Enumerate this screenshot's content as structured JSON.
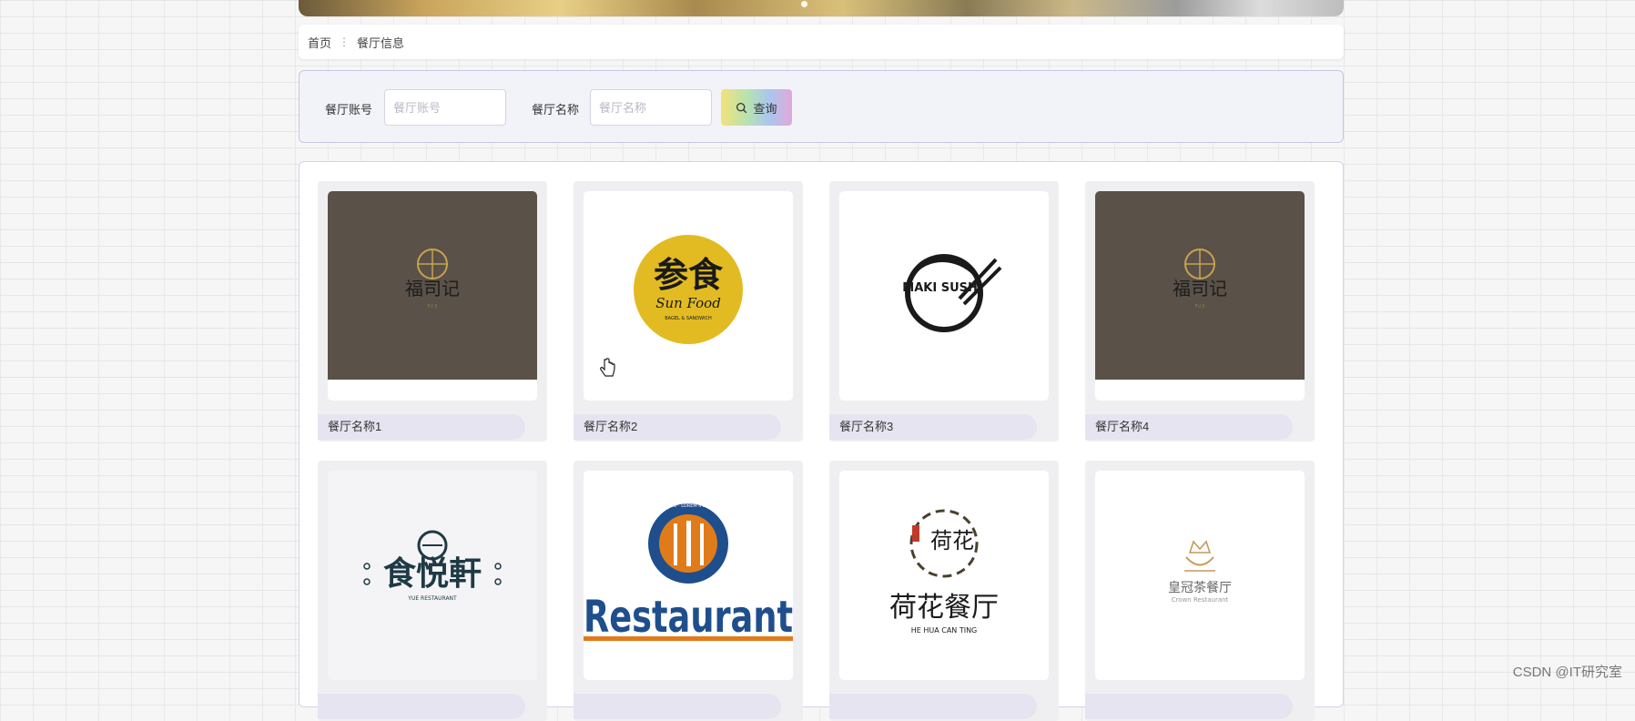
{
  "breadcrumb": {
    "home": "首页",
    "current": "餐厅信息"
  },
  "search": {
    "account_label": "餐厅账号",
    "account_placeholder": "餐厅账号",
    "account_value": "",
    "name_label": "餐厅名称",
    "name_placeholder": "餐厅名称",
    "name_value": "",
    "button_label": "查询",
    "button_icon": "search-icon"
  },
  "restaurants": [
    {
      "name": "餐厅名称1",
      "logo": "fu-ji-logo",
      "logo_text": "福司记",
      "logo_sub": "FU JI"
    },
    {
      "name": "餐厅名称2",
      "logo": "sun-food-logo",
      "logo_text": "参食",
      "logo_sub": "Sun Food",
      "logo_small": "BAGEL & SANDWICH"
    },
    {
      "name": "餐厅名称3",
      "logo": "maki-sushi-logo",
      "logo_text": "MAKI SUSHI"
    },
    {
      "name": "餐厅名称4",
      "logo": "fu-ji-logo",
      "logo_text": "福司记",
      "logo_sub": "FU JI"
    },
    {
      "name": "",
      "logo": "yue-xuan-logo",
      "logo_text": "食悦軒",
      "logo_sub": "YUE RESTAURANT"
    },
    {
      "name": "",
      "logo": "restaurant-logo",
      "logo_text": "Restaurant",
      "logo_small": "LOGO · LOREM IPSUM"
    },
    {
      "name": "",
      "logo": "he-hua-logo",
      "logo_text": "荷花餐厅",
      "logo_mark": "荷花",
      "logo_sub": "HE HUA CAN TING"
    },
    {
      "name": "",
      "logo": "crown-logo",
      "logo_text": "皇冠茶餐厅",
      "logo_sub": "Crown Restaurant"
    }
  ],
  "watermark": "CSDN @IT研究室",
  "colors": {
    "page_bg": "#f6f6f6",
    "panel_border": "#c9c6e3",
    "name_bar": "#e6e4f0",
    "fu_ji_bg": "#5a5148",
    "sun_food_yellow": "#e2bb22",
    "restaurant_blue": "#1f4e8c",
    "restaurant_orange": "#e07b1a"
  }
}
